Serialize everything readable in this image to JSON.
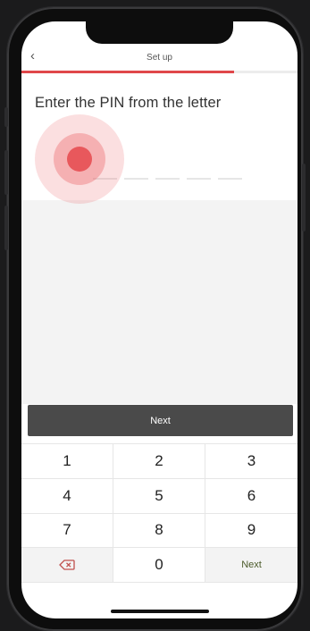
{
  "header": {
    "title": "Set up",
    "back_icon": "chevron-left-icon"
  },
  "progress": {
    "fraction": 0.77,
    "color": "#e0474a"
  },
  "prompt": {
    "text": "Enter the PIN from the letter"
  },
  "pin": {
    "length": 5
  },
  "primary_button": {
    "label": "Next"
  },
  "keypad": {
    "keys": [
      "1",
      "2",
      "3",
      "4",
      "5",
      "6",
      "7",
      "8",
      "9"
    ],
    "zero": "0",
    "delete_icon": "backspace-icon",
    "next_label": "Next"
  }
}
